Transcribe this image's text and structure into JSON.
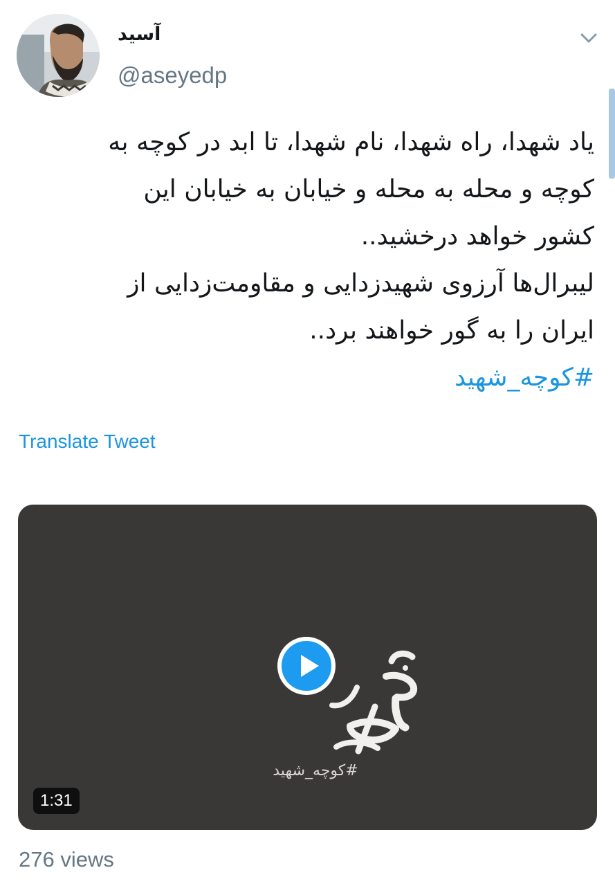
{
  "author": {
    "display_name": "آسید",
    "handle": "@aseyedp",
    "avatar_icon": "profile-photo"
  },
  "tweet": {
    "lines": [
      "یاد شهدا، راه شهدا، نام شهدا، تا ابد در کوچه به",
      "کوچه و محله به محله و خیابان به خیابان این",
      "کشور خواهد درخشید..",
      "لیبرال‌ها آرزوی شهیدزدایی و مقاومت‌زدایی از",
      "ایران را به گور خواهند برد.."
    ],
    "hashtag": "#کوچه_شهید",
    "translate_label": "Translate Tweet"
  },
  "video": {
    "duration": "1:31",
    "overlay_hashtag": "#کوچه_شهید",
    "logo_icon": "nokte-calligraphy-logo",
    "play_icon": "play-icon"
  },
  "stats": {
    "views": "276 views"
  },
  "colors": {
    "link": "#1b95e0",
    "secondary_text": "#657786",
    "video_background": "#3a3836"
  }
}
